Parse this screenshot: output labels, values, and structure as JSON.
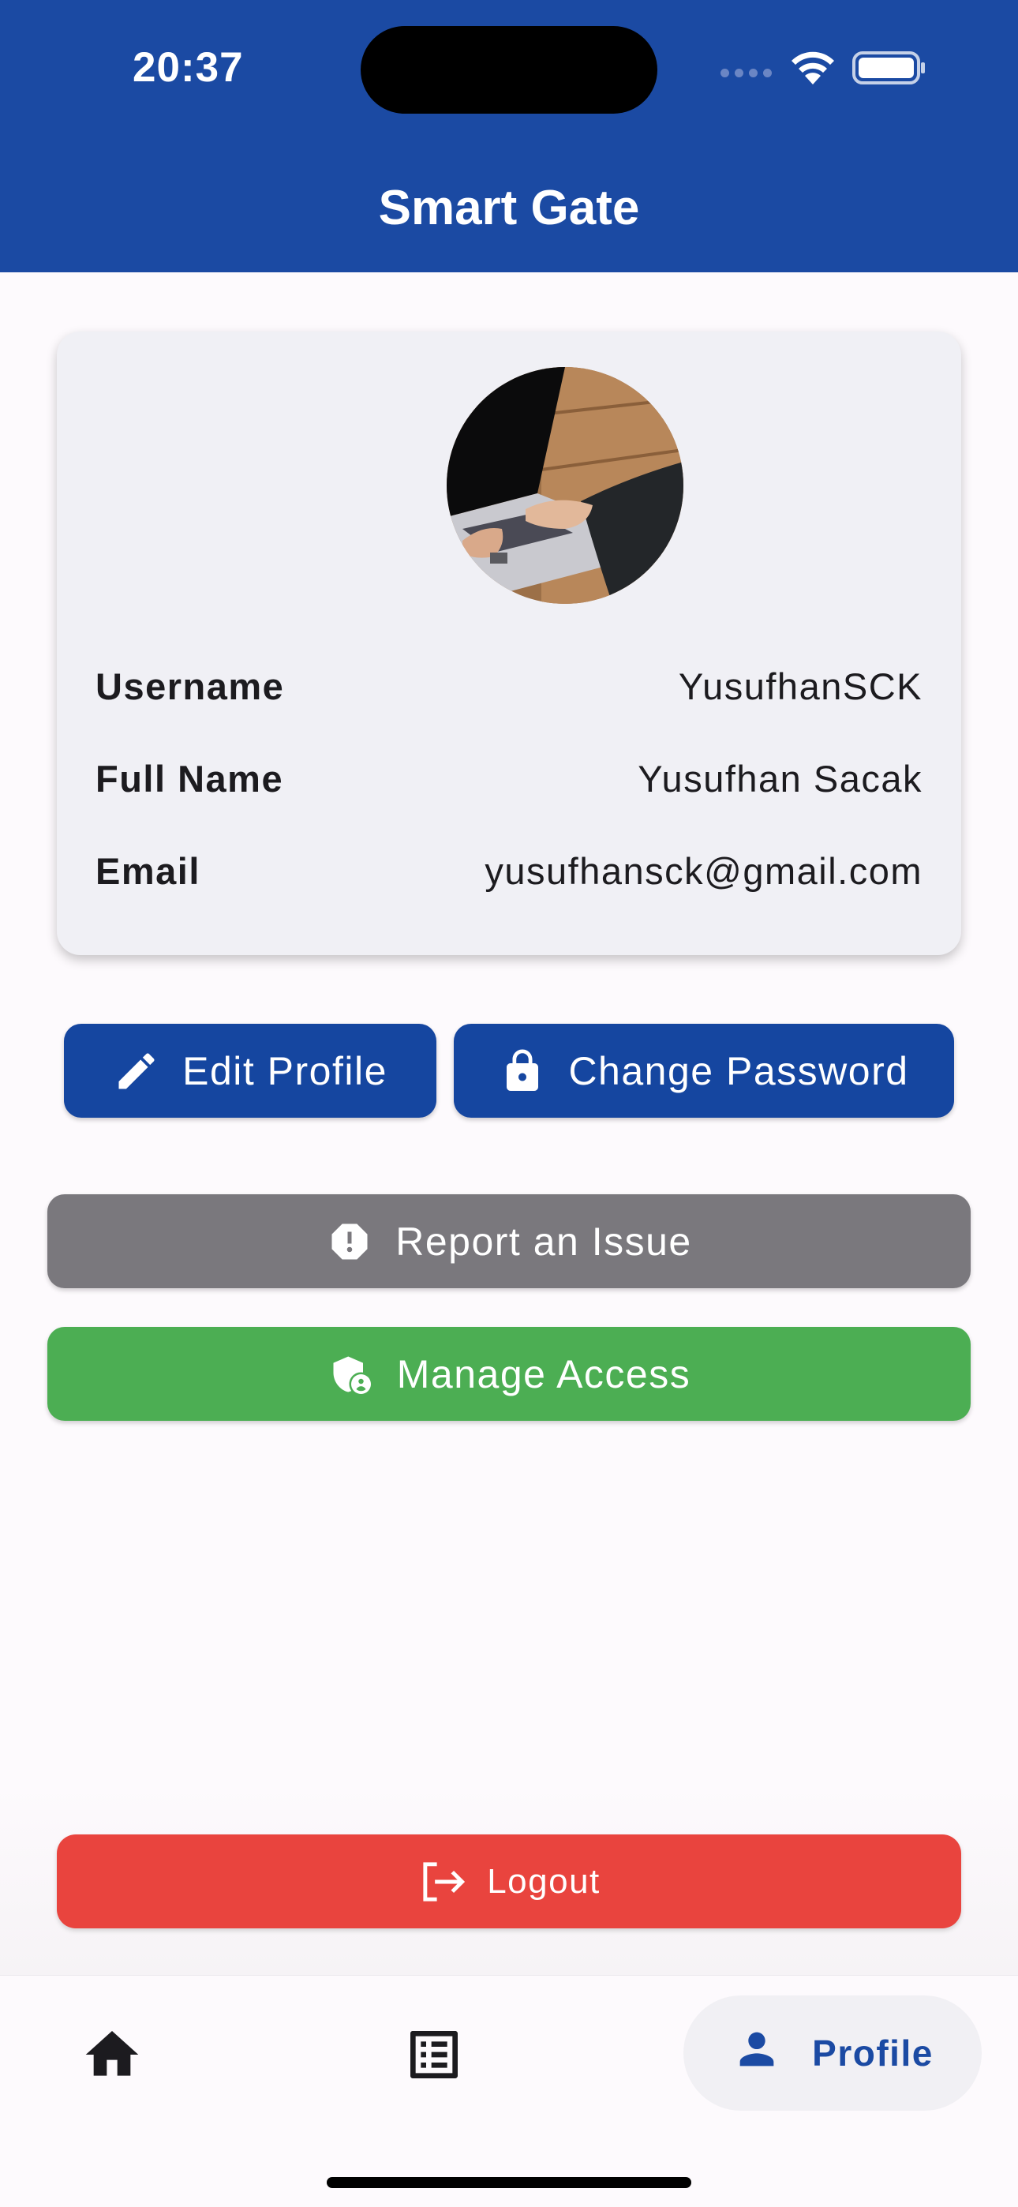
{
  "status_bar": {
    "time": "20:37"
  },
  "header": {
    "title": "Smart Gate"
  },
  "profile": {
    "fields": [
      {
        "label": "Username",
        "value": "YusufhanSCK"
      },
      {
        "label": "Full Name",
        "value": "Yusufhan Sacak"
      },
      {
        "label": "Email",
        "value": "yusufhansck@gmail.com"
      }
    ]
  },
  "actions": {
    "edit_profile": "Edit Profile",
    "change_password": "Change Password",
    "report_issue": "Report an Issue",
    "manage_access": "Manage Access",
    "logout": "Logout"
  },
  "nav": {
    "items": [
      {
        "icon": "home-icon",
        "label": ""
      },
      {
        "icon": "list-icon",
        "label": ""
      },
      {
        "icon": "person-icon",
        "label": "Profile",
        "active": true
      }
    ]
  },
  "colors": {
    "primary": "#1b4aa3",
    "gray_button": "#7a787d",
    "green_button": "#4cae53",
    "red_button": "#e9443e"
  }
}
